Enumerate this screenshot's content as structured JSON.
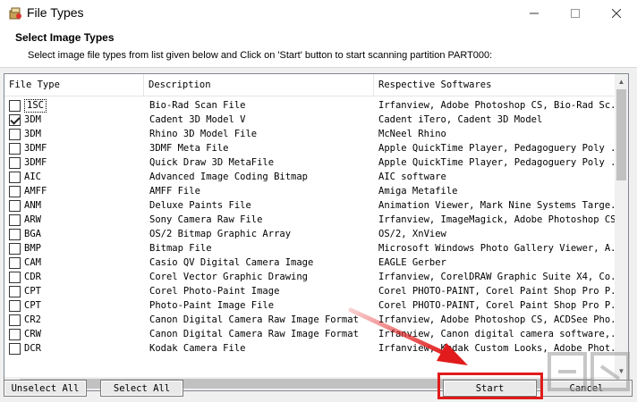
{
  "window": {
    "title": "File Types"
  },
  "header": {
    "title": "Select Image Types",
    "subtitle": "Select image file types from list given below and Click on 'Start' button to start scanning partition PART000:"
  },
  "columns": [
    "File Type",
    "Description",
    "Respective Softwares"
  ],
  "rows": [
    {
      "type": "1SC",
      "desc": "Bio-Rad Scan File",
      "soft": "Irfanview, Adobe Photoshop CS, Bio-Rad Sc...",
      "checked": false
    },
    {
      "type": "3DM",
      "desc": "Cadent 3D Model V",
      "soft": "Cadent iTero, Cadent 3D Model",
      "checked": true
    },
    {
      "type": "3DM",
      "desc": "Rhino 3D Model File",
      "soft": "McNeel Rhino",
      "checked": false
    },
    {
      "type": "3DMF",
      "desc": "3DMF Meta File",
      "soft": "Apple QuickTime Player, Pedagoguery Poly ...",
      "checked": false
    },
    {
      "type": "3DMF",
      "desc": "Quick Draw 3D MetaFile",
      "soft": "Apple QuickTime Player, Pedagoguery Poly ...",
      "checked": false
    },
    {
      "type": "AIC",
      "desc": "Advanced Image Coding Bitmap",
      "soft": "AIC software",
      "checked": false
    },
    {
      "type": "AMFF",
      "desc": "AMFF File",
      "soft": "Amiga Metafile",
      "checked": false
    },
    {
      "type": "ANM",
      "desc": "Deluxe Paints File",
      "soft": "Animation Viewer, Mark Nine Systems Targe...",
      "checked": false
    },
    {
      "type": "ARW",
      "desc": "Sony Camera Raw File",
      "soft": "Irfanview, ImageMagick, Adobe Photoshop CS",
      "checked": false
    },
    {
      "type": "BGA",
      "desc": "OS/2 Bitmap Graphic Array",
      "soft": "OS/2, XnView",
      "checked": false
    },
    {
      "type": "BMP",
      "desc": "Bitmap File",
      "soft": "Microsoft Windows Photo Gallery Viewer, A...",
      "checked": false
    },
    {
      "type": "CAM",
      "desc": "Casio QV Digital Camera Image",
      "soft": "EAGLE Gerber",
      "checked": false
    },
    {
      "type": "CDR",
      "desc": "Corel Vector Graphic Drawing",
      "soft": "Irfanview, CorelDRAW Graphic Suite X4, Co...",
      "checked": false
    },
    {
      "type": "CPT",
      "desc": "Corel Photo-Paint Image",
      "soft": "Corel PHOTO-PAINT, Corel Paint Shop Pro P...",
      "checked": false
    },
    {
      "type": "CPT",
      "desc": "Photo-Paint Image File",
      "soft": "Corel PHOTO-PAINT, Corel Paint Shop Pro P...",
      "checked": false
    },
    {
      "type": "CR2",
      "desc": "Canon Digital Camera Raw Image Format",
      "soft": "Irfanview, Adobe Photoshop CS, ACDSee Pho...",
      "checked": false
    },
    {
      "type": "CRW",
      "desc": "Canon Digital Camera Raw Image Format",
      "soft": "Irfanview, Canon digital camera software,...",
      "checked": false
    },
    {
      "type": "DCR",
      "desc": "Kodak Camera File",
      "soft": "Irfanview, Kodak Custom Looks, Adobe Phot...",
      "checked": false
    }
  ],
  "buttons": {
    "unselect_all": "Unselect All",
    "select_all": "Select All",
    "start": "Start",
    "cancel": "Cancel"
  },
  "colors": {
    "highlight": "#e11b1b",
    "arrow": "#e11b1b"
  }
}
